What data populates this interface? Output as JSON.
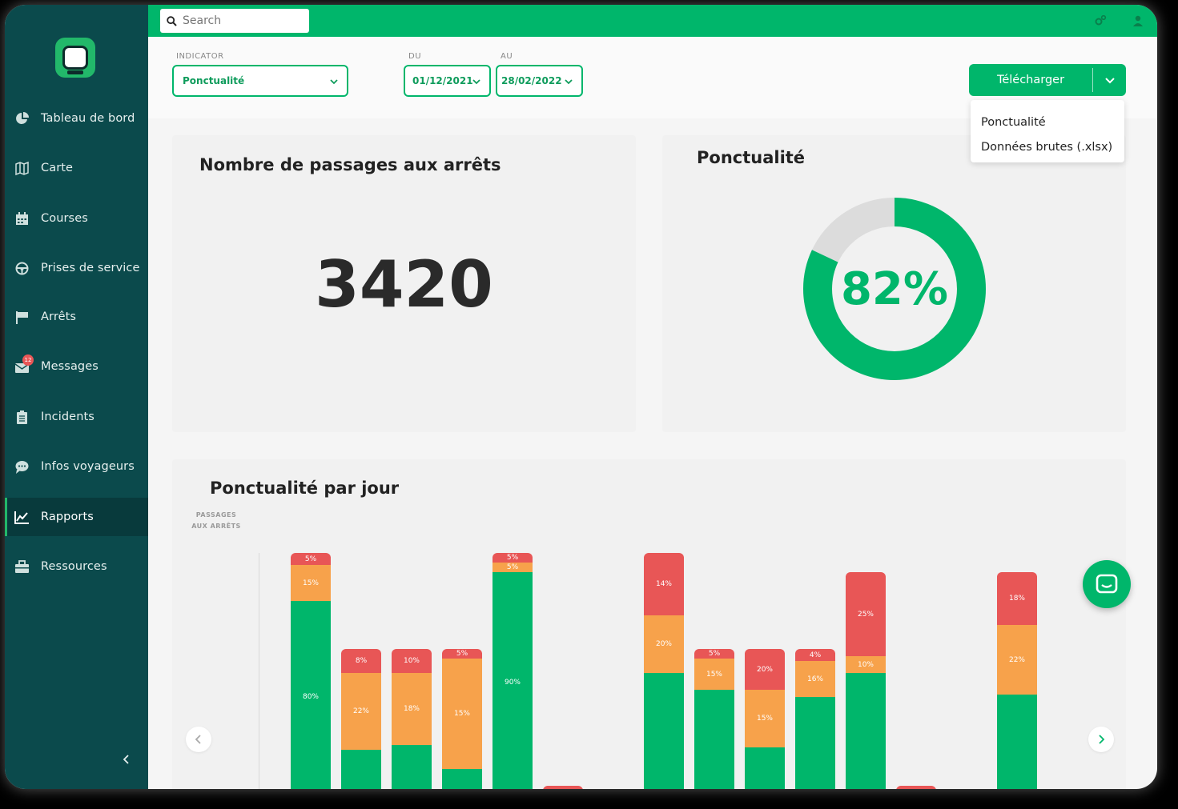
{
  "search": {
    "placeholder": "Search"
  },
  "sidebar": {
    "items": [
      {
        "label": "Tableau de bord",
        "icon": "pie-chart-icon"
      },
      {
        "label": "Carte",
        "icon": "map-icon"
      },
      {
        "label": "Courses",
        "icon": "calendar-icon"
      },
      {
        "label": "Prises de service",
        "icon": "steering-wheel-icon"
      },
      {
        "label": "Arrêts",
        "icon": "stop-sign-icon"
      },
      {
        "label": "Messages",
        "icon": "envelope-icon",
        "badge": "12"
      },
      {
        "label": "Incidents",
        "icon": "clipboard-icon"
      },
      {
        "label": "Infos voyageurs",
        "icon": "chat-bubble-icon"
      },
      {
        "label": "Rapports",
        "icon": "line-chart-icon",
        "active": true
      },
      {
        "label": "Ressources",
        "icon": "toolbox-icon"
      }
    ]
  },
  "filters": {
    "indicator_label": "INDICATOR",
    "indicator_value": "Ponctualité",
    "from_label": "DU",
    "from_value": "01/12/2021",
    "to_label": "AU",
    "to_value": "28/02/2022"
  },
  "download": {
    "label": "Télécharger",
    "menu": [
      "Ponctualité",
      "Données brutes (.xlsx)"
    ]
  },
  "cards": {
    "passages_title": "Nombre de passages aux arrêts",
    "passages_value": "3420",
    "punctuality_title": "Ponctualité",
    "punctuality_value": "82%",
    "punctuality_fraction": 0.82
  },
  "colors": {
    "brand": "#00b66b",
    "sidebar": "#0b4a4c",
    "on_time": "#00b66b",
    "late": "#f7a24b",
    "very_late": "#e85656",
    "track": "#dcdcdc"
  },
  "chart_data": {
    "type": "bar",
    "title": "Ponctualité par jour",
    "ylabel": "PASSAGES AUX ARRÊTS",
    "stacked": true,
    "bars": [
      {
        "total": 100,
        "segments": [
          {
            "label": "80%",
            "value": 80,
            "kind": "on_time"
          },
          {
            "label": "15%",
            "value": 15,
            "kind": "late"
          },
          {
            "label": "5%",
            "value": 5,
            "kind": "very_late"
          }
        ]
      },
      {
        "total": 60,
        "segments": [
          {
            "label": "",
            "value": 18,
            "kind": "on_time"
          },
          {
            "label": "22%",
            "value": 32,
            "kind": "late"
          },
          {
            "label": "8%",
            "value": 10,
            "kind": "very_late"
          }
        ]
      },
      {
        "total": 60,
        "segments": [
          {
            "label": "",
            "value": 20,
            "kind": "on_time"
          },
          {
            "label": "18%",
            "value": 30,
            "kind": "late"
          },
          {
            "label": "10%",
            "value": 10,
            "kind": "very_late"
          }
        ]
      },
      {
        "total": 60,
        "segments": [
          {
            "label": "",
            "value": 10,
            "kind": "on_time"
          },
          {
            "label": "15%",
            "value": 46,
            "kind": "late"
          },
          {
            "label": "5%",
            "value": 4,
            "kind": "very_late"
          }
        ]
      },
      {
        "total": 100,
        "segments": [
          {
            "label": "90%",
            "value": 92,
            "kind": "on_time"
          },
          {
            "label": "5%",
            "value": 4,
            "kind": "late"
          },
          {
            "label": "5%",
            "value": 4,
            "kind": "very_late"
          }
        ]
      },
      {
        "total": 3,
        "segments": [
          {
            "label": "",
            "value": 3,
            "kind": "very_late"
          }
        ]
      },
      {
        "total": 0,
        "segments": []
      },
      {
        "total": 100,
        "segments": [
          {
            "label": "",
            "value": 50,
            "kind": "on_time"
          },
          {
            "label": "20%",
            "value": 24,
            "kind": "late"
          },
          {
            "label": "14%",
            "value": 26,
            "kind": "very_late"
          }
        ]
      },
      {
        "total": 60,
        "segments": [
          {
            "label": "",
            "value": 43,
            "kind": "on_time"
          },
          {
            "label": "15%",
            "value": 13,
            "kind": "late"
          },
          {
            "label": "5%",
            "value": 4,
            "kind": "very_late"
          }
        ]
      },
      {
        "total": 60,
        "segments": [
          {
            "label": "",
            "value": 19,
            "kind": "on_time"
          },
          {
            "label": "15%",
            "value": 24,
            "kind": "late"
          },
          {
            "label": "20%",
            "value": 17,
            "kind": "very_late"
          }
        ]
      },
      {
        "total": 60,
        "segments": [
          {
            "label": "",
            "value": 40,
            "kind": "on_time"
          },
          {
            "label": "16%",
            "value": 15,
            "kind": "late"
          },
          {
            "label": "4%",
            "value": 5,
            "kind": "very_late"
          }
        ]
      },
      {
        "total": 92,
        "segments": [
          {
            "label": "",
            "value": 50,
            "kind": "on_time"
          },
          {
            "label": "10%",
            "value": 7,
            "kind": "late"
          },
          {
            "label": "25%",
            "value": 35,
            "kind": "very_late"
          }
        ]
      },
      {
        "total": 3,
        "segments": [
          {
            "label": "",
            "value": 3,
            "kind": "very_late"
          }
        ]
      },
      {
        "total": 0,
        "segments": []
      },
      {
        "total": 92,
        "segments": [
          {
            "label": "",
            "value": 41,
            "kind": "on_time"
          },
          {
            "label": "22%",
            "value": 29,
            "kind": "late"
          },
          {
            "label": "18%",
            "value": 22,
            "kind": "very_late"
          }
        ]
      }
    ]
  }
}
